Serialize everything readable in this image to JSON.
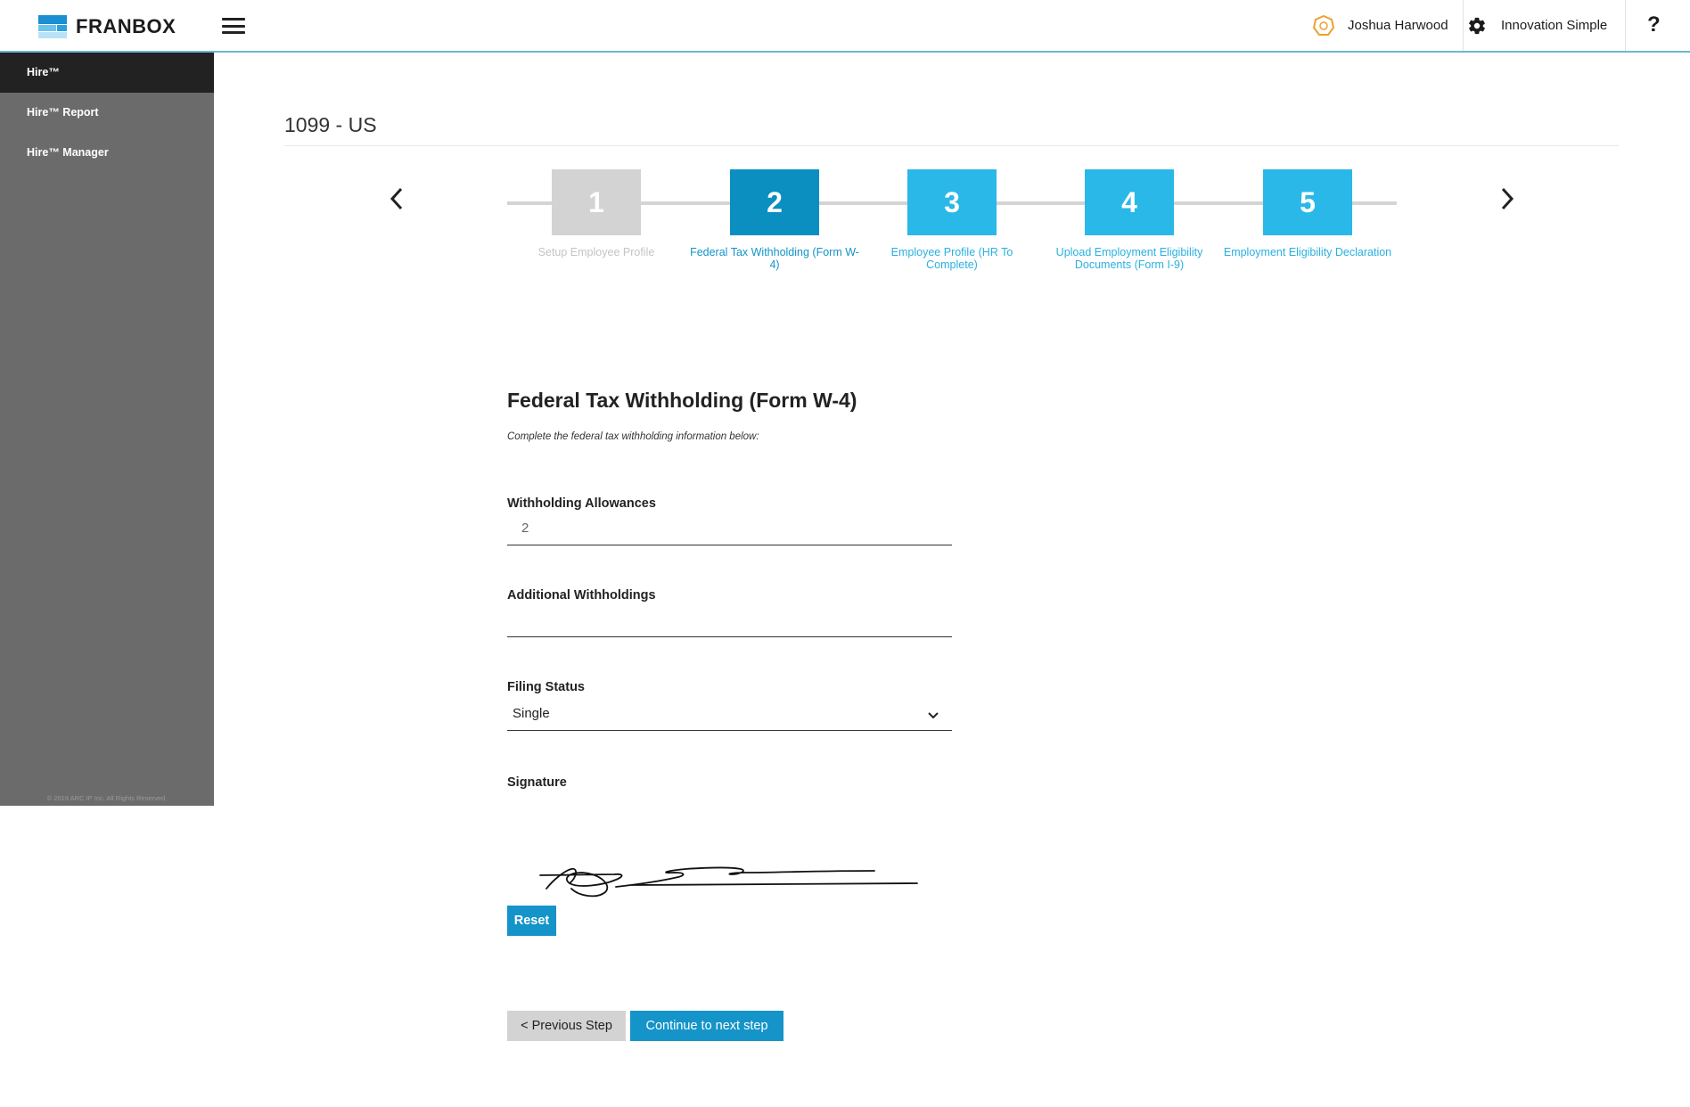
{
  "header": {
    "logo_text": "FRANBOX",
    "user_name": "Joshua Harwood",
    "org_name": "Innovation Simple",
    "help_label": "?"
  },
  "sidebar": {
    "items": [
      {
        "label": "Hire™",
        "active": true
      },
      {
        "label": "Hire™ Report",
        "active": false
      },
      {
        "label": "Hire™ Manager",
        "active": false
      }
    ],
    "footer": "© 2019 ARC IP Inc. All Rights Reserved."
  },
  "page": {
    "title": "1099 - US"
  },
  "steps": [
    {
      "number": "1",
      "label": "Setup Employee Profile",
      "state": "done"
    },
    {
      "number": "2",
      "label": "Federal Tax Withholding (Form W-4)",
      "state": "current"
    },
    {
      "number": "3",
      "label": "Employee Profile (HR To Complete)",
      "state": "upcoming"
    },
    {
      "number": "4",
      "label": "Upload Employment Eligibility Documents (Form I-9)",
      "state": "upcoming"
    },
    {
      "number": "5",
      "label": "Employment Eligibility Declaration",
      "state": "upcoming"
    }
  ],
  "form": {
    "heading": "Federal Tax Withholding (Form W-4)",
    "subtitle": "Complete the federal tax withholding information below:",
    "withholding_allowances": {
      "label": "Withholding Allowances",
      "value": "2"
    },
    "additional_withholdings": {
      "label": "Additional Withholdings",
      "value": ""
    },
    "filing_status": {
      "label": "Filing Status",
      "value": "Single"
    },
    "signature": {
      "label": "Signature"
    },
    "reset_label": "Reset",
    "prev_label": "< Previous Step",
    "next_label": "Continue to next step"
  },
  "colors": {
    "step_done": "#d3d3d3",
    "step_current": "#0b8fc0",
    "step_upcoming": "#2ab8e8",
    "label_done": "#c4c4c4",
    "label_active": "#1494c8",
    "label_upcoming": "#2ab0e0",
    "button_primary": "#1494c8",
    "sidebar_bg": "#6b6b6b",
    "sidebar_active": "#222222"
  },
  "icons": {
    "user": "user-avatar-icon",
    "settings": "gear-icon",
    "menu": "hamburger-icon",
    "prev": "chevron-left-icon",
    "next": "chevron-right-icon",
    "dropdown": "chevron-down-icon"
  }
}
